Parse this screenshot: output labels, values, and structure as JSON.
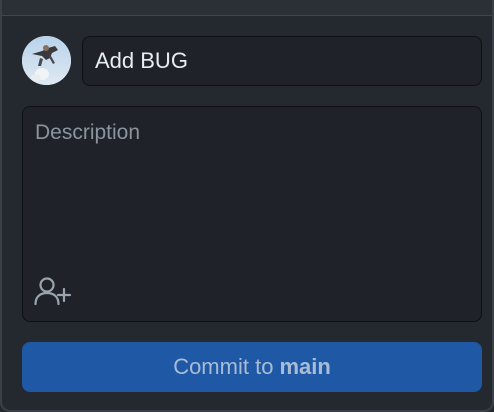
{
  "commit_panel": {
    "summary": {
      "value": "Add BUG"
    },
    "description": {
      "placeholder": "Description"
    },
    "coauthor_icon": "person-add-icon",
    "commit_button": {
      "prefix": "Commit to",
      "branch": "main"
    }
  },
  "colors": {
    "button_bg": "#1f58a5",
    "field_bg": "#1f2329",
    "panel_bg": "#24292f"
  }
}
